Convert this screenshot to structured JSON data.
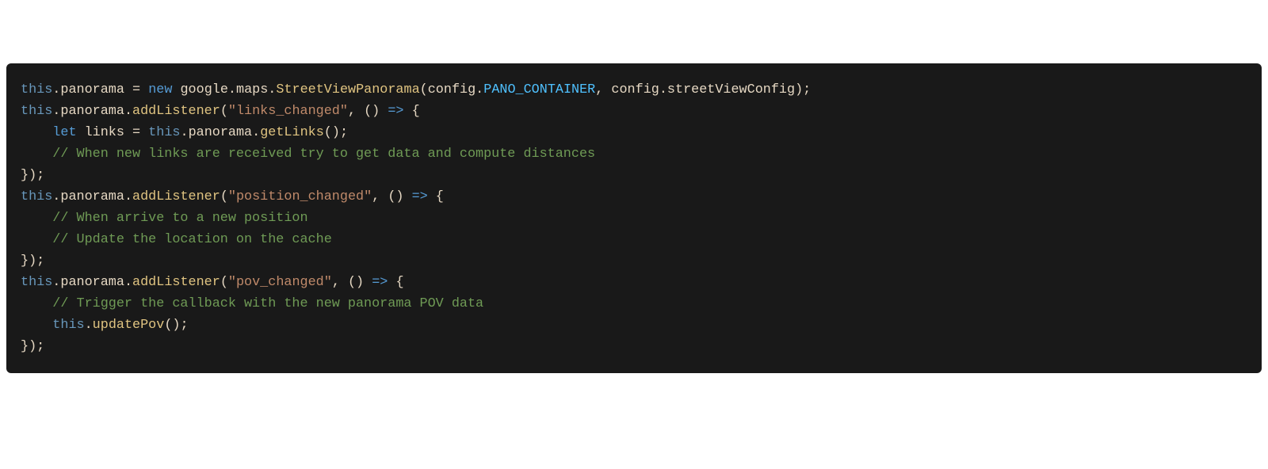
{
  "code": {
    "line1": {
      "this": "this",
      "dot1": ".",
      "panorama": "panorama",
      "sp1": " ",
      "eq": "=",
      "sp2": " ",
      "new": "new",
      "sp3": " ",
      "google": "google",
      "dot2": ".",
      "maps": "maps",
      "dot3": ".",
      "svp": "StreetViewPanorama",
      "lp": "(",
      "config1": "config",
      "dot4": ".",
      "const": "PANO_CONTAINER",
      "comma": ",",
      "sp4": " ",
      "config2": "config",
      "dot5": ".",
      "svc": "streetViewConfig",
      "rp": ")",
      "semi": ";"
    },
    "line2": {
      "this": "this",
      "dot1": ".",
      "panorama": "panorama",
      "dot2": ".",
      "addListener": "addListener",
      "lp": "(",
      "str": "\"links_changed\"",
      "comma": ",",
      "sp": " ",
      "paren": "()",
      "sp2": " ",
      "arrow": "=>",
      "sp3": " ",
      "brace": "{"
    },
    "line3": {
      "indent": "    ",
      "let": "let",
      "sp1": " ",
      "links": "links",
      "sp2": " ",
      "eq": "=",
      "sp3": " ",
      "this": "this",
      "dot1": ".",
      "panorama": "panorama",
      "dot2": ".",
      "getLinks": "getLinks",
      "paren": "()",
      "semi": ";"
    },
    "line4": {
      "indent": "    ",
      "comment": "// When new links are received try to get data and compute distances"
    },
    "line5": {
      "close": "});"
    },
    "line6": {
      "blank": ""
    },
    "line7": {
      "this": "this",
      "dot1": ".",
      "panorama": "panorama",
      "dot2": ".",
      "addListener": "addListener",
      "lp": "(",
      "str": "\"position_changed\"",
      "comma": ",",
      "sp": " ",
      "paren": "()",
      "sp2": " ",
      "arrow": "=>",
      "sp3": " ",
      "brace": "{"
    },
    "line8": {
      "indent": "    ",
      "comment": "// When arrive to a new position"
    },
    "line9": {
      "indent": "    ",
      "comment": "// Update the location on the cache"
    },
    "line10": {
      "close": "});"
    },
    "line11": {
      "blank": ""
    },
    "line12": {
      "this": "this",
      "dot1": ".",
      "panorama": "panorama",
      "dot2": ".",
      "addListener": "addListener",
      "lp": "(",
      "str": "\"pov_changed\"",
      "comma": ",",
      "sp": " ",
      "paren": "()",
      "sp2": " ",
      "arrow": "=>",
      "sp3": " ",
      "brace": "{"
    },
    "line13": {
      "indent": "    ",
      "comment": "// Trigger the callback with the new panorama POV data"
    },
    "line14": {
      "indent": "    ",
      "this": "this",
      "dot1": ".",
      "updatePov": "updatePov",
      "paren": "()",
      "semi": ";"
    },
    "line15": {
      "close": "});"
    }
  }
}
